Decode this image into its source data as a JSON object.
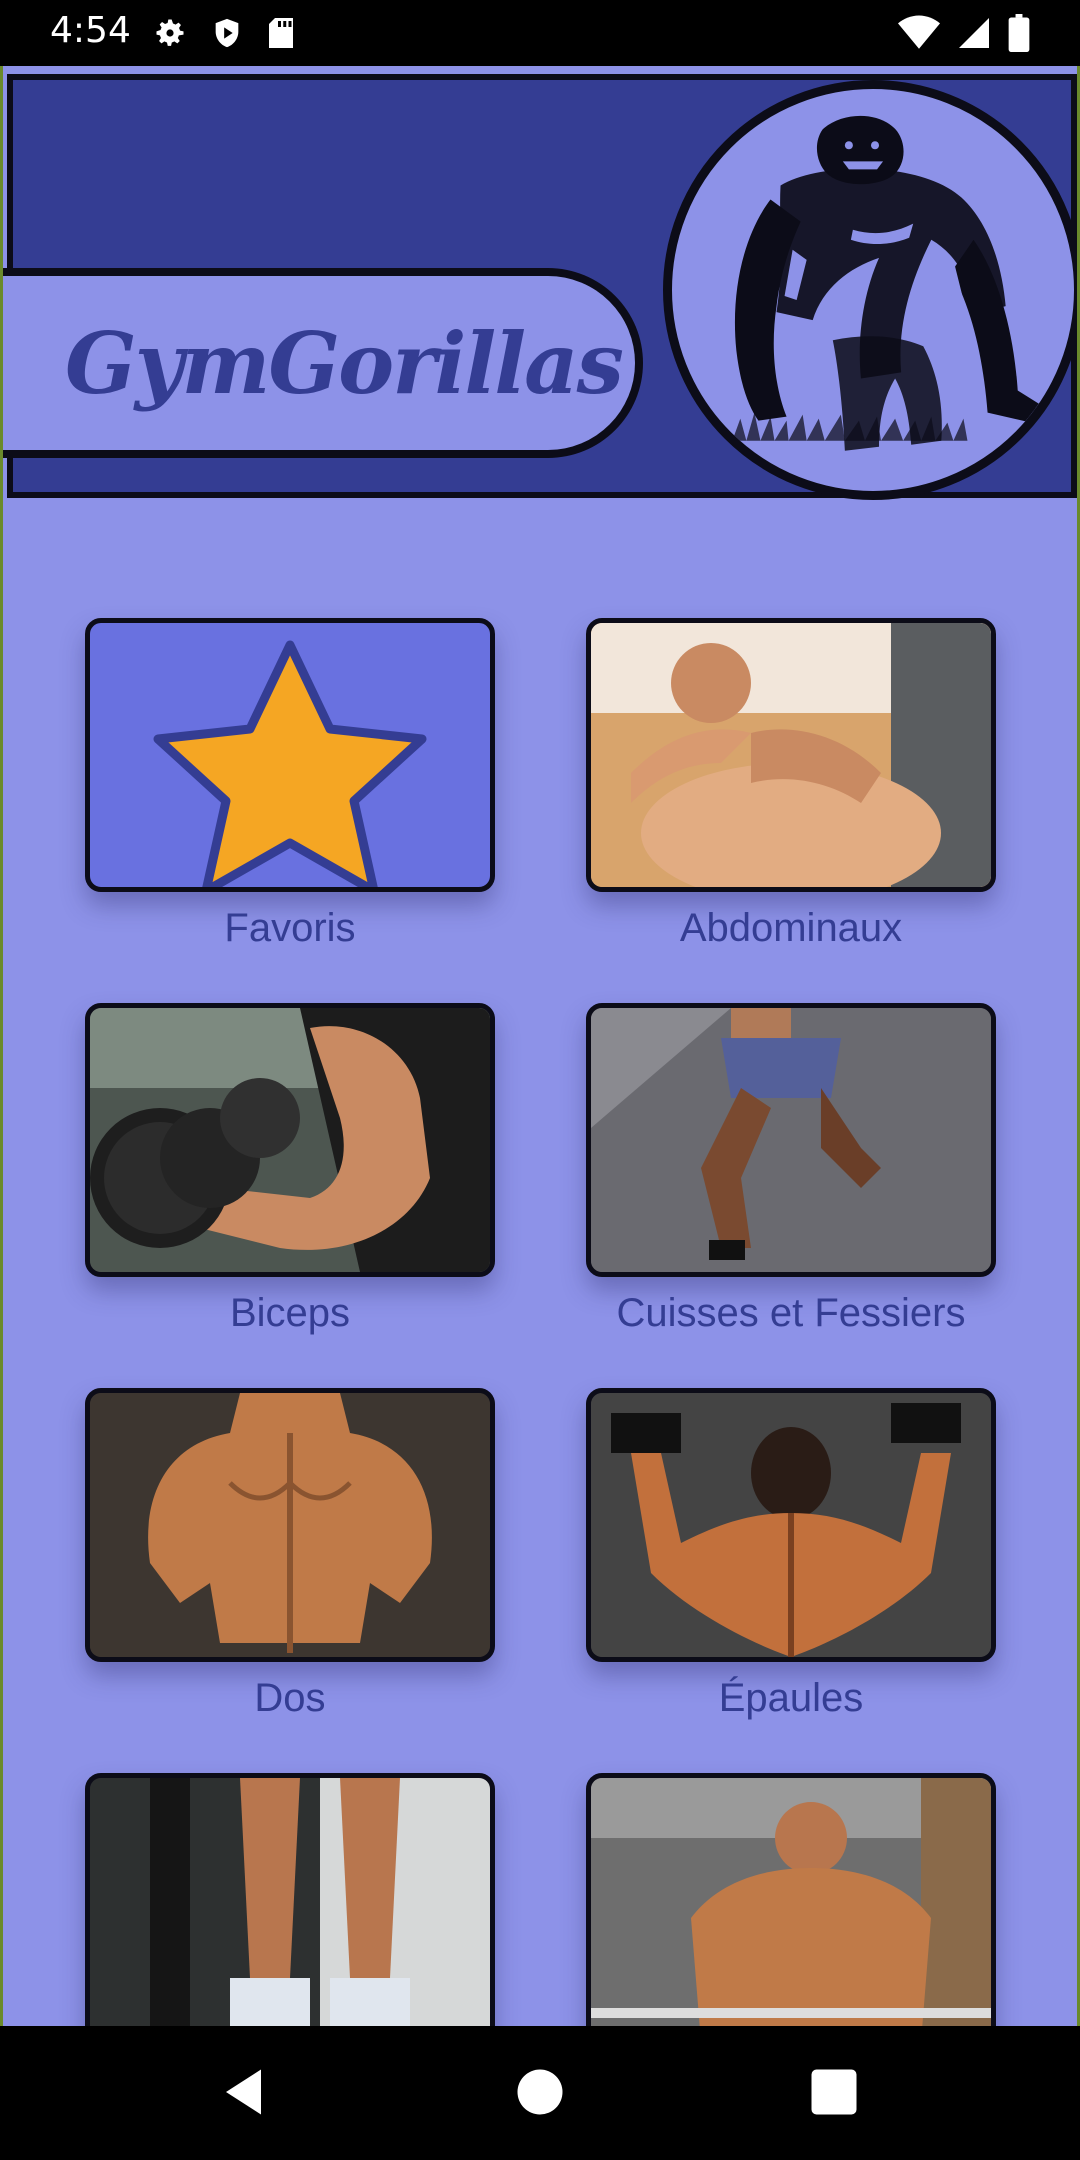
{
  "status_bar": {
    "time": "4:54",
    "left_icons": [
      "gear-icon",
      "play-protect-icon",
      "sd-card-icon"
    ],
    "right_icons": [
      "wifi-icon",
      "signal-icon",
      "battery-icon"
    ]
  },
  "header": {
    "app_title": "GymGorillas",
    "logo": "gorilla-logo"
  },
  "categories": [
    {
      "label": "Favoris",
      "image": "star-icon"
    },
    {
      "label": "Abdominaux",
      "image": "abs-photo"
    },
    {
      "label": "Biceps",
      "image": "biceps-photo"
    },
    {
      "label": "Cuisses et Fessiers",
      "image": "legs-photo"
    },
    {
      "label": "Dos",
      "image": "back-photo"
    },
    {
      "label": "Épaules",
      "image": "shoulders-photo"
    },
    {
      "label": "",
      "image": "calves-photo"
    },
    {
      "label": "",
      "image": "chest-photo"
    }
  ],
  "nav_bar": {
    "buttons": [
      "back-icon",
      "home-icon",
      "recents-icon"
    ]
  },
  "colors": {
    "background": "#8d92e8",
    "header": "#343d93",
    "label_text": "#343d93",
    "star_fill": "#f5a623",
    "star_card": "#6971e0"
  }
}
